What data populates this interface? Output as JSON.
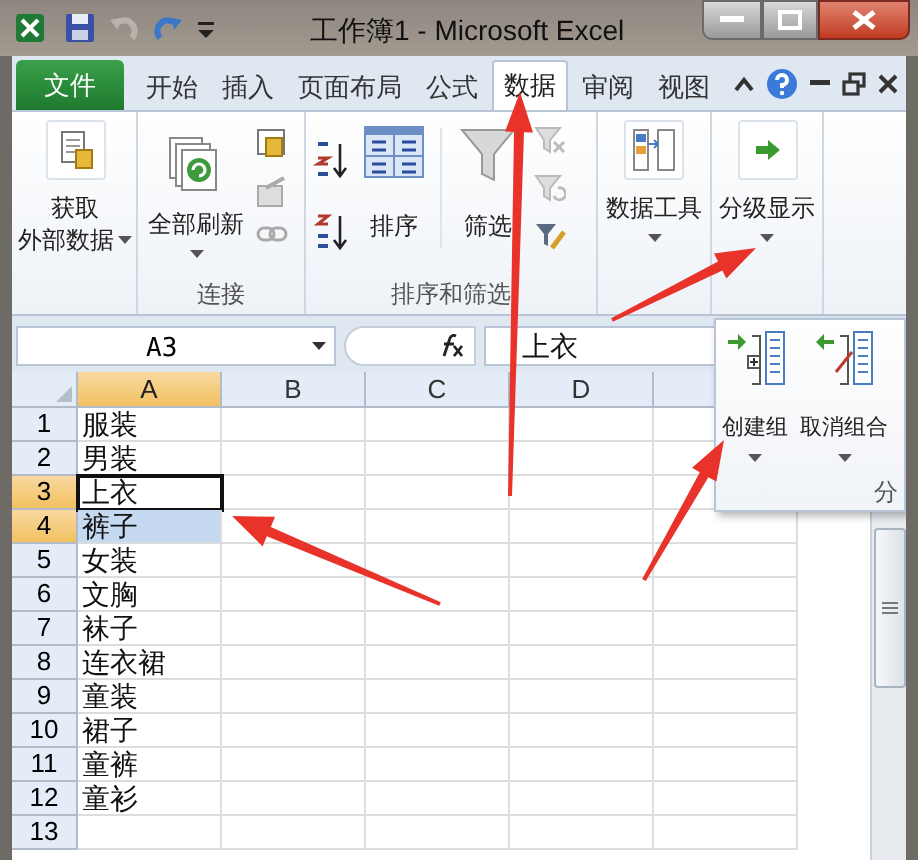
{
  "window": {
    "title": "工作簿1 - Microsoft Excel"
  },
  "file_tab": "文件",
  "tabs": [
    {
      "label": "开始",
      "selected": false
    },
    {
      "label": "插入",
      "selected": false
    },
    {
      "label": "页面布局",
      "selected": false
    },
    {
      "label": "公式",
      "selected": false
    },
    {
      "label": "数据",
      "selected": true
    },
    {
      "label": "审阅",
      "selected": false
    },
    {
      "label": "视图",
      "selected": false
    }
  ],
  "ribbon": {
    "get_external_data": [
      "获取",
      "外部数据"
    ],
    "refresh_all": "全部刷新",
    "connections_label": "连接",
    "sort": "排序",
    "filter": "筛选",
    "sort_filter_label": "排序和筛选",
    "data_tools": "数据工具",
    "outline": "分级显示"
  },
  "outline_panel": {
    "buttons": [
      {
        "label": "创建组"
      },
      {
        "label": "取消组合"
      }
    ],
    "group_label": "分"
  },
  "name_box": "A3",
  "formula": "上衣",
  "columns": [
    {
      "label": "A",
      "selected": true
    },
    {
      "label": "B",
      "selected": false
    },
    {
      "label": "C",
      "selected": false
    },
    {
      "label": "D",
      "selected": false
    }
  ],
  "rows": [
    {
      "number": "1",
      "cell": "服装",
      "selected": false,
      "active": false
    },
    {
      "number": "2",
      "cell": "男装",
      "selected": false,
      "active": false
    },
    {
      "number": "3",
      "cell": "上衣",
      "selected": true,
      "active": true
    },
    {
      "number": "4",
      "cell": "裤子",
      "selected": true,
      "active": false
    },
    {
      "number": "5",
      "cell": "女装",
      "selected": false,
      "active": false
    },
    {
      "number": "6",
      "cell": "文胸",
      "selected": false,
      "active": false
    },
    {
      "number": "7",
      "cell": "袜子",
      "selected": false,
      "active": false
    },
    {
      "number": "8",
      "cell": "连衣裙",
      "selected": false,
      "active": false
    },
    {
      "number": "9",
      "cell": "童装",
      "selected": false,
      "active": false
    },
    {
      "number": "10",
      "cell": "裙子",
      "selected": false,
      "active": false
    },
    {
      "number": "11",
      "cell": "童裤",
      "selected": false,
      "active": false
    },
    {
      "number": "12",
      "cell": "童衫",
      "selected": false,
      "active": false
    },
    {
      "number": "13",
      "selected": false,
      "active": false
    }
  ]
}
